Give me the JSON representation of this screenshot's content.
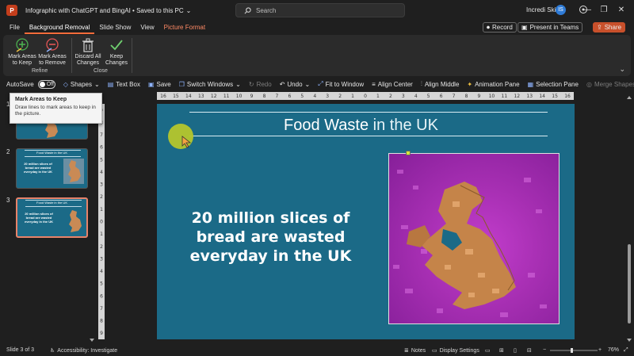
{
  "titlebar": {
    "app_letter": "P",
    "doc_title": "Infographic with ChatGPT and BingAI • Saved to this PC",
    "search_placeholder": "Search",
    "user_name": "Incredi Skill",
    "avatar_initial": "IS",
    "accent_color": "#c43e1c"
  },
  "tabs": [
    {
      "label": "File"
    },
    {
      "label": "Background Removal"
    },
    {
      "label": "Slide Show"
    },
    {
      "label": "View"
    },
    {
      "label": "Picture Format"
    }
  ],
  "top_buttons": {
    "record": "Record",
    "present": "Present in Teams",
    "share": "Share"
  },
  "ribbon": {
    "mark_keep": "Mark Areas to Keep",
    "mark_remove": "Mark Areas to Remove",
    "refine_label": "Refine",
    "discard": "Discard All Changes",
    "keep_changes": "Keep Changes",
    "close_label": "Close"
  },
  "qat": {
    "autosave": "AutoSave",
    "autosave_state": "Off",
    "shapes": "Shapes",
    "text_box": "Text Box",
    "save": "Save",
    "switch_windows": "Switch Windows",
    "redo": "Redo",
    "undo": "Undo",
    "fit_to_window": "Fit to Window",
    "align_center": "Align Center",
    "align_middle": "Align Middle",
    "animation_pane": "Animation Pane",
    "selection_pane": "Selection Pane",
    "merge_shapes": "Merge Shapes"
  },
  "tooltip": {
    "title": "Mark Areas to Keep",
    "body": "Draw lines to mark areas to keep in the picture."
  },
  "thumbnails": [
    {
      "number": "1",
      "title": "",
      "text": ""
    },
    {
      "number": "2",
      "title": "Food Waste in the UK",
      "text": "20 million slices of bread are wasted everyday in the UK"
    },
    {
      "number": "3",
      "title": "Food Waste in the UK",
      "text": "20 million slices of bread are wasted everyday in the UK"
    }
  ],
  "ruler": {
    "h_ticks": [
      "16",
      "15",
      "14",
      "13",
      "12",
      "11",
      "10",
      "9",
      "8",
      "7",
      "6",
      "5",
      "4",
      "3",
      "2",
      "1",
      "0",
      "1",
      "2",
      "3",
      "4",
      "5",
      "6",
      "7",
      "8",
      "9",
      "10",
      "11",
      "12",
      "13",
      "14",
      "15",
      "16"
    ],
    "v_ticks": [
      "9",
      "8",
      "7",
      "6",
      "5",
      "4",
      "3",
      "2",
      "1",
      "0",
      "1",
      "2",
      "3",
      "4",
      "5",
      "6",
      "7",
      "8",
      "9"
    ]
  },
  "slide": {
    "title_main": "Food Waste",
    "title_rest": " in the UK",
    "body_text": "20 million slices of bread are wasted everyday in the UK",
    "bg_color": "#1b6a87",
    "picture_bg": "#a72fb3"
  },
  "statusbar": {
    "slide_info": "Slide 3 of 3",
    "accessibility": "Accessibility: Investigate",
    "notes": "Notes",
    "display_settings": "Display Settings",
    "zoom": "76%"
  }
}
